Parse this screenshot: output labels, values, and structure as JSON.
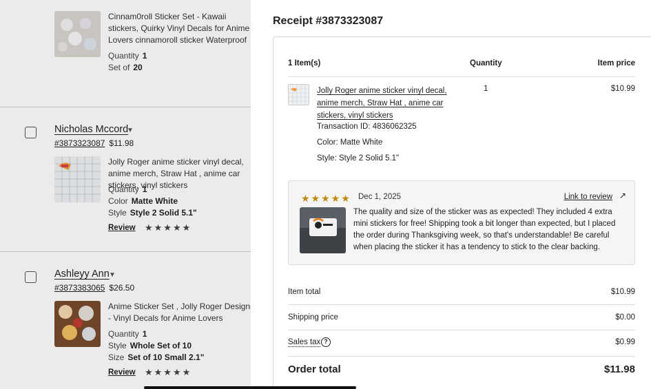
{
  "orders": [
    {
      "item_title": "Cinnam0roll Sticker Set - Kawaii stickers, Quirky Vinyl Decals for Anime Lovers cinnamoroll sticker Waterproof",
      "quantity_label": "Quantity",
      "quantity": "1",
      "set_label": "Set of",
      "set_value": "20"
    },
    {
      "buyer": "Nicholas Mccord",
      "receipt_id": "#3873323087",
      "amount": "$11.98",
      "item_title": "Jolly Roger anime sticker vinyl decal, anime merch, Straw Hat , anime car stickers, vinyl stickers",
      "quantity_label": "Quantity",
      "quantity": "1",
      "color_label": "Color",
      "color_value": "Matte White",
      "style_label": "Style",
      "style_value": "Style 2 Solid 5.1\"",
      "review_label": "Review"
    },
    {
      "buyer": "Ashleyy Ann",
      "receipt_id": "#3873383065",
      "amount": "$26.50",
      "item_title": "Anime Sticker Set , Jolly Roger Designs - Vinyl Decals for Anime Lovers",
      "quantity_label": "Quantity",
      "quantity": "1",
      "style_label": "Style",
      "style_value": "Whole Set of 10",
      "size_label": "Size",
      "size_value": "Set of 10 Small 2.1\"",
      "review_label": "Review"
    }
  ],
  "receipt": {
    "title": "Receipt #3873323087",
    "items_count": "1 Item(s)",
    "quantity_header": "Quantity",
    "price_header": "Item price",
    "item": {
      "title": "Jolly Roger anime sticker vinyl decal, anime merch, Straw Hat , anime car stickers, vinyl stickers",
      "transaction": "Transaction ID: 4836062325",
      "color": "Color: Matte White",
      "style": "Style: Style 2 Solid 5.1\"",
      "quantity": "1",
      "price": "$10.99"
    },
    "review": {
      "rating": 5,
      "stars": "★★★★★",
      "date": "Dec 1, 2025",
      "link_label": "Link to review",
      "text": "The quality and size of the sticker was as expected! They included 4 extra mini stickers for free! Shipping took a bit longer than expected, but I placed the order during Thanksgiving week, so that's understandable! Be careful when placing the sticker it has a tendency to stick to the clear backing."
    },
    "summary": {
      "item_total_label": "Item total",
      "item_total": "$10.99",
      "shipping_label": "Shipping price",
      "shipping": "$0.00",
      "tax_label": "Sales tax",
      "tax": "$0.99",
      "order_total_label": "Order total",
      "order_total": "$11.98"
    }
  },
  "icons": {
    "star": "star-icon",
    "help": "help-icon",
    "external": "external-link-icon",
    "caret": "caret-down-icon"
  },
  "colors": {
    "star_gold": "#c08a00",
    "border": "#dcdcdc"
  }
}
